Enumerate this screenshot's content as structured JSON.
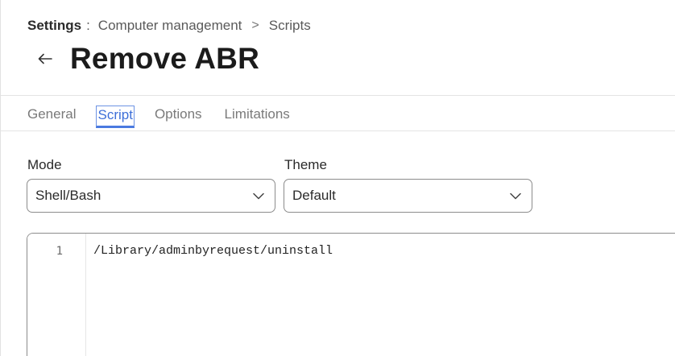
{
  "breadcrumb": {
    "root": "Settings",
    "separator": ":",
    "section": "Computer management",
    "chevron": ">",
    "current": "Scripts"
  },
  "header": {
    "title": "Remove ABR",
    "back_icon": "arrow-left-icon"
  },
  "tabs": [
    {
      "label": "General",
      "active": false
    },
    {
      "label": "Script",
      "active": true
    },
    {
      "label": "Options",
      "active": false
    },
    {
      "label": "Limitations",
      "active": false
    }
  ],
  "form": {
    "mode": {
      "label": "Mode",
      "value": "Shell/Bash",
      "icon": "chevron-down-icon"
    },
    "theme": {
      "label": "Theme",
      "value": "Default",
      "icon": "chevron-down-icon"
    }
  },
  "editor": {
    "lines": [
      {
        "number": "1",
        "text": "/Library/adminbyrequest/uninstall"
      }
    ]
  },
  "colors": {
    "accent": "#3d6fd8",
    "title": "#1b1b1b",
    "muted_text": "#7a7a7a",
    "border": "#8c8c8c"
  }
}
